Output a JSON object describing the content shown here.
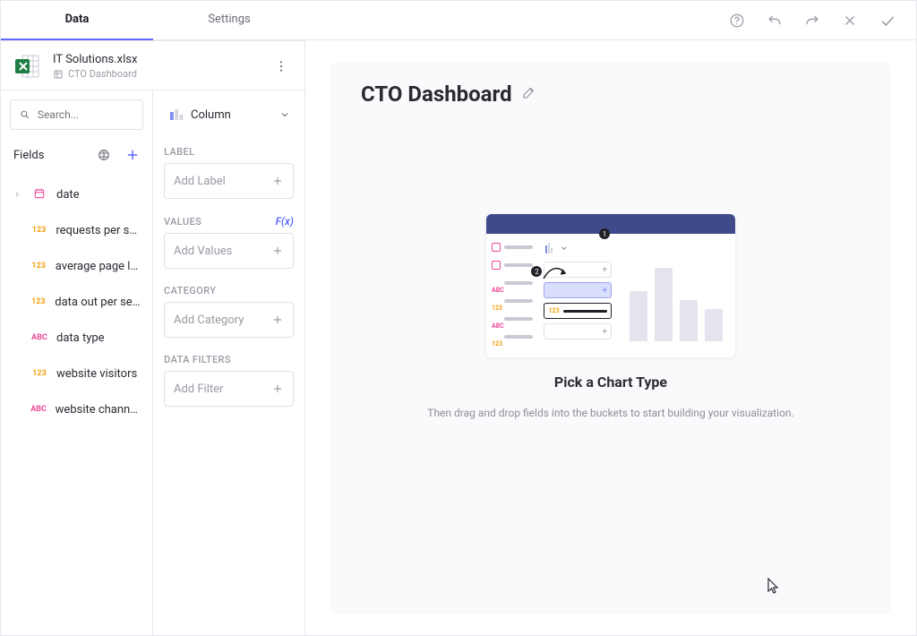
{
  "tabs": {
    "data": "Data",
    "settings": "Settings"
  },
  "file": {
    "name": "IT Solutions.xlsx",
    "sheet": "CTO Dashboard"
  },
  "search": {
    "placeholder": "Search..."
  },
  "fields_section_title": "Fields",
  "fields": [
    {
      "type": "cal",
      "label": "date",
      "expandable": true
    },
    {
      "type": "123",
      "label": "requests per se…"
    },
    {
      "type": "123",
      "label": "average page lo…"
    },
    {
      "type": "123",
      "label": "data out per sec…"
    },
    {
      "type": "abc",
      "label": "data type"
    },
    {
      "type": "123",
      "label": "website visitors"
    },
    {
      "type": "abc",
      "label": "website channels"
    }
  ],
  "chart_type": "Column",
  "sections": {
    "label": {
      "heading": "LABEL",
      "placeholder": "Add Label"
    },
    "values": {
      "heading": "VALUES",
      "fx": "F(x)",
      "placeholder": "Add Values"
    },
    "category": {
      "heading": "CATEGORY",
      "placeholder": "Add Category"
    },
    "filters": {
      "heading": "DATA FILTERS",
      "placeholder": "Add Filter"
    }
  },
  "dashboard": {
    "title": "CTO Dashboard"
  },
  "placeholder": {
    "title": "Pick a Chart Type",
    "subtitle": "Then drag and drop fields into the buckets to start building your visualization."
  }
}
